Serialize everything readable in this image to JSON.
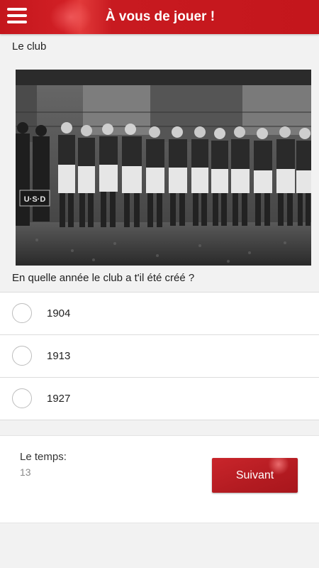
{
  "header": {
    "title": "À vous de jouer !",
    "menu_icon": "hamburger-menu-icon",
    "bar_color": "#c4161c"
  },
  "section": {
    "title": "Le club"
  },
  "photo": {
    "badge_text": "U·S·D"
  },
  "quiz": {
    "question": "En quelle année le club a t'il été créé ?",
    "options": [
      {
        "label": "1904",
        "selected": false
      },
      {
        "label": "1913",
        "selected": false
      },
      {
        "label": "1927",
        "selected": false
      }
    ]
  },
  "footer": {
    "timer_label": "Le temps:",
    "timer_value": "13",
    "next_label": "Suivant",
    "button_color": "#b31b21"
  }
}
